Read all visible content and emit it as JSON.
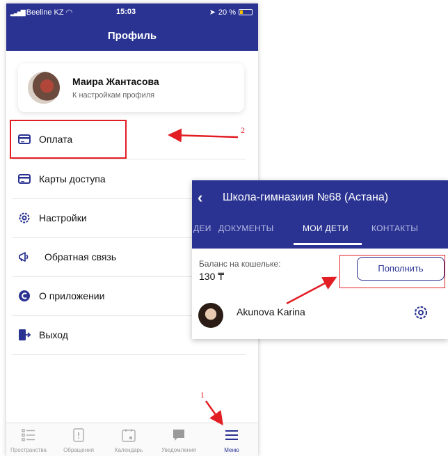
{
  "status_bar": {
    "carrier": "Beeline KZ",
    "time": "15:03",
    "battery": "20 %"
  },
  "header": {
    "title": "Профиль"
  },
  "profile": {
    "name": "Маира Жантасова",
    "subtitle": "К настройкам профиля"
  },
  "menu": [
    {
      "label": "Оплата",
      "icon": "card-icon"
    },
    {
      "label": "Карты доступа",
      "icon": "card-icon"
    },
    {
      "label": "Настройки",
      "icon": "gear-icon"
    },
    {
      "label": "Обратная связь",
      "icon": "megaphone-icon"
    },
    {
      "label": "О приложении",
      "icon": "info-c-icon"
    },
    {
      "label": "Выход",
      "icon": "logout-icon"
    }
  ],
  "tabbar": [
    {
      "label": "Пространства",
      "icon": "list-icon"
    },
    {
      "label": "Обращения",
      "icon": "clipboard-icon"
    },
    {
      "label": "Календарь",
      "icon": "calendar-icon"
    },
    {
      "label": "Уведомления",
      "icon": "chat-icon"
    },
    {
      "label": "Меню",
      "icon": "hamburger-icon",
      "active": true
    }
  ],
  "panel": {
    "title": "Школа-гимназиия №68 (Астана)",
    "tabs": [
      {
        "label": "ДЕИ"
      },
      {
        "label": "ДОКУМЕНТЫ"
      },
      {
        "label": "МОИ ДЕТИ",
        "active": true
      },
      {
        "label": "КОНТАКТЫ"
      }
    ],
    "balance_label": "Баланс на кошельке:",
    "balance_value": "130 ₸",
    "topup_label": "Пополнить",
    "child_name": "Akunova Karina"
  },
  "annotations": {
    "step1": "1",
    "step2": "2"
  },
  "colors": {
    "brand": "#2a3392",
    "annotation": "#e21d24"
  }
}
